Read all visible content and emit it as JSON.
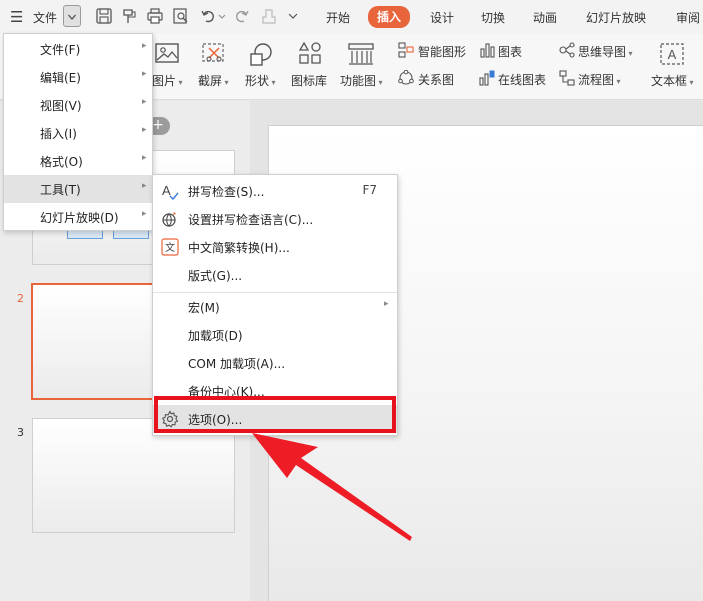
{
  "topbar": {
    "file_label": "文件",
    "tabs": [
      {
        "label": "开始"
      },
      {
        "label": "插入"
      },
      {
        "label": "设计"
      },
      {
        "label": "切换"
      },
      {
        "label": "动画"
      },
      {
        "label": "幻灯片放映"
      },
      {
        "label": "审阅"
      }
    ],
    "active_tab": "插入",
    "accent_color": "#e8643a"
  },
  "ribbon": {
    "row1": {
      "smartart": "智能图形",
      "chart": "图表",
      "mindmap": "思维导图"
    },
    "row2": {
      "picture": "图片",
      "screenshot": "截屏",
      "shape": "形状",
      "iconlib": "图标库",
      "funcchart": "功能图",
      "relation": "关系图",
      "onlinechart": "在线图表",
      "flowchart": "流程图",
      "textbox": "文本框"
    }
  },
  "slides": {
    "numbers": [
      "2",
      "3"
    ],
    "selected": "2"
  },
  "file_menu": {
    "items": [
      {
        "label": "文件(F)"
      },
      {
        "label": "编辑(E)"
      },
      {
        "label": "视图(V)"
      },
      {
        "label": "插入(I)"
      },
      {
        "label": "格式(O)"
      },
      {
        "label": "工具(T)"
      },
      {
        "label": "幻灯片放映(D)"
      }
    ],
    "highlighted": "工具(T)"
  },
  "tools_menu": {
    "items": [
      {
        "label": "拼写检查(S)...",
        "shortcut": "F7",
        "icon": "spellcheck-icon"
      },
      {
        "label": "设置拼写检查语言(C)...",
        "icon": "globe-language-icon"
      },
      {
        "label": "中文简繁转换(H)...",
        "icon": "chinese-convert-icon"
      },
      {
        "label": "版式(G)..."
      },
      {
        "label": "宏(M)"
      },
      {
        "label": "加载项(D)"
      },
      {
        "label": "COM 加载项(A)..."
      },
      {
        "label": "备份中心(K)..."
      },
      {
        "label": "选项(O)...",
        "icon": "gear-icon"
      }
    ],
    "highlighted": "选项(O)..."
  },
  "annotation": {
    "highlight_color": "#e8121d"
  }
}
